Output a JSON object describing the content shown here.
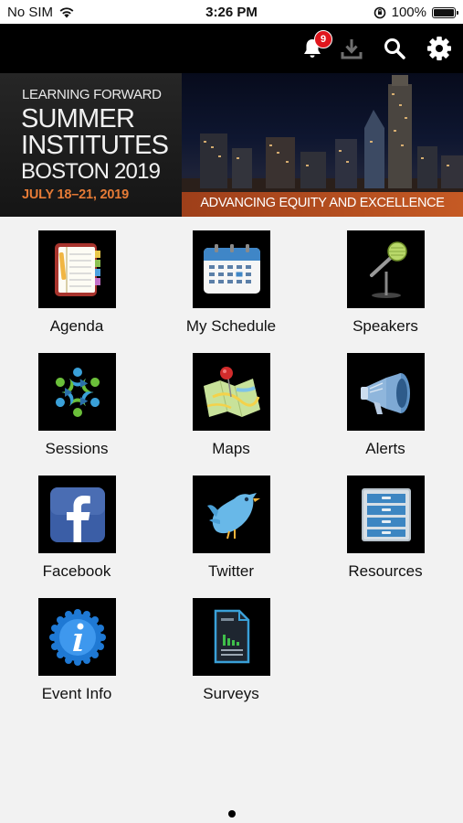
{
  "status_bar": {
    "carrier": "No SIM",
    "time": "3:26 PM",
    "battery": "100%",
    "battery_level": 1.0
  },
  "toolbar": {
    "notification_count": "9",
    "icons": [
      "bell-icon",
      "download-icon",
      "search-icon",
      "gear-icon"
    ]
  },
  "banner": {
    "subtitle": "LEARNING FORWARD",
    "title_line1": "SUMMER",
    "title_line2": "INSTITUTES",
    "title_line3": "BOSTON 2019",
    "dates": "JULY 18–21, 2019",
    "tagline": "ADVANCING EQUITY AND EXCELLENCE",
    "accent_color": "#e67b36"
  },
  "tiles": [
    {
      "label": "Agenda",
      "icon": "agenda-icon"
    },
    {
      "label": "My Schedule",
      "icon": "calendar-icon"
    },
    {
      "label": "Speakers",
      "icon": "microphone-icon"
    },
    {
      "label": "Sessions",
      "icon": "people-circle-icon"
    },
    {
      "label": "Maps",
      "icon": "map-icon"
    },
    {
      "label": "Alerts",
      "icon": "megaphone-icon"
    },
    {
      "label": "Facebook",
      "icon": "facebook-icon"
    },
    {
      "label": "Twitter",
      "icon": "twitter-bird-icon"
    },
    {
      "label": "Resources",
      "icon": "filing-cabinet-icon"
    },
    {
      "label": "Event Info",
      "icon": "info-icon"
    },
    {
      "label": "Surveys",
      "icon": "survey-document-icon"
    }
  ]
}
